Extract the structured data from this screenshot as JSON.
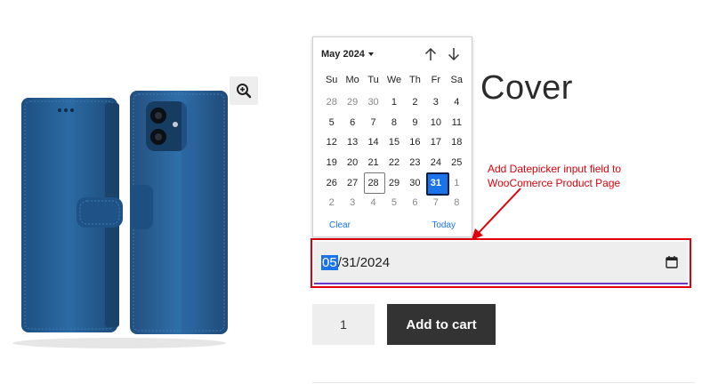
{
  "product": {
    "title": "Cover",
    "image_alt": "blue-flip-phone-case"
  },
  "calendar": {
    "month_label": "May 2024",
    "weekdays": [
      "Su",
      "Mo",
      "Tu",
      "We",
      "Th",
      "Fr",
      "Sa"
    ],
    "days": [
      {
        "d": "28",
        "other": true
      },
      {
        "d": "29",
        "other": true
      },
      {
        "d": "30",
        "other": true
      },
      {
        "d": "1"
      },
      {
        "d": "2"
      },
      {
        "d": "3"
      },
      {
        "d": "4"
      },
      {
        "d": "5"
      },
      {
        "d": "6"
      },
      {
        "d": "7"
      },
      {
        "d": "8"
      },
      {
        "d": "9"
      },
      {
        "d": "10"
      },
      {
        "d": "11"
      },
      {
        "d": "12"
      },
      {
        "d": "13"
      },
      {
        "d": "14"
      },
      {
        "d": "15"
      },
      {
        "d": "16"
      },
      {
        "d": "17"
      },
      {
        "d": "18"
      },
      {
        "d": "19"
      },
      {
        "d": "20"
      },
      {
        "d": "21"
      },
      {
        "d": "22"
      },
      {
        "d": "23"
      },
      {
        "d": "24"
      },
      {
        "d": "25"
      },
      {
        "d": "26"
      },
      {
        "d": "27"
      },
      {
        "d": "28",
        "today": true
      },
      {
        "d": "29"
      },
      {
        "d": "30"
      },
      {
        "d": "31",
        "selected": true
      },
      {
        "d": "1",
        "other": true
      },
      {
        "d": "2",
        "other": true
      },
      {
        "d": "3",
        "other": true
      },
      {
        "d": "4",
        "other": true
      },
      {
        "d": "5",
        "other": true
      },
      {
        "d": "6",
        "other": true
      },
      {
        "d": "7",
        "other": true
      },
      {
        "d": "8",
        "other": true
      }
    ],
    "clear_label": "Clear",
    "today_label": "Today"
  },
  "date_field": {
    "month": "05",
    "rest": "/31/2024",
    "icon": "calendar-icon"
  },
  "annotation": {
    "text": "Add Datepicker input field to WooComerce Product Page",
    "color": "#e0000b"
  },
  "cart": {
    "quantity": "1",
    "add_label": "Add to cart"
  },
  "colors": {
    "accent": "#1a73e8",
    "button_bg": "#333333",
    "highlight": "#e0000b"
  }
}
